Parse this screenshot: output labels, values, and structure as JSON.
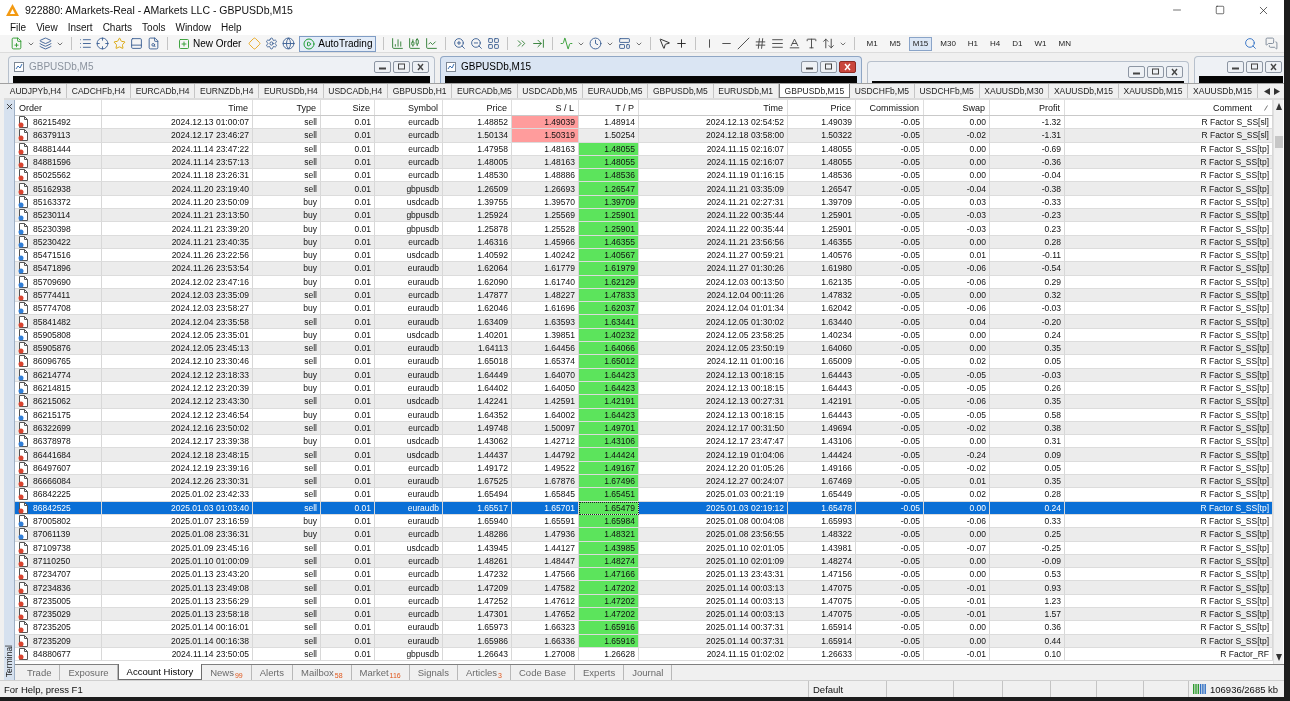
{
  "window": {
    "title": "922880: AMarkets-Real - AMarkets LLC - GBPUSDb,M15"
  },
  "menu": [
    "File",
    "View",
    "Insert",
    "Charts",
    "Tools",
    "Window",
    "Help"
  ],
  "toolbar": {
    "new_order": "New Order",
    "autotrading": {
      "label": "AutoTrading",
      "on": true
    },
    "timeframes": [
      {
        "label": "M1",
        "selected": false
      },
      {
        "label": "M5",
        "selected": false
      },
      {
        "label": "M15",
        "selected": true
      },
      {
        "label": "M30",
        "selected": false
      },
      {
        "label": "H1",
        "selected": false
      },
      {
        "label": "H4",
        "selected": false
      },
      {
        "label": "D1",
        "selected": false
      },
      {
        "label": "W1",
        "selected": false
      },
      {
        "label": "MN",
        "selected": false
      }
    ]
  },
  "chart_windows": [
    {
      "title": "GBPUSDb,M5",
      "active": false
    },
    {
      "title": "GBPUSDb,M15",
      "active": true
    },
    {
      "active": false
    },
    {
      "active": false
    }
  ],
  "chart_tabs": [
    {
      "label": "AUDJPYb,H4",
      "selected": false
    },
    {
      "label": "CADCHFb,H4",
      "selected": false
    },
    {
      "label": "EURCADb,H4",
      "selected": false
    },
    {
      "label": "EURNZDb,H4",
      "selected": false
    },
    {
      "label": "EURUSDb,H4",
      "selected": false
    },
    {
      "label": "USDCADb,H4",
      "selected": false
    },
    {
      "label": "GBPUSDb,H1",
      "selected": false
    },
    {
      "label": "EURCADb,M5",
      "selected": false
    },
    {
      "label": "USDCADb,M5",
      "selected": false
    },
    {
      "label": "EURAUDb,M5",
      "selected": false
    },
    {
      "label": "GBPUSDb,M5",
      "selected": false
    },
    {
      "label": "EURUSDb,M1",
      "selected": false
    },
    {
      "label": "GBPUSDb,M15",
      "selected": true
    },
    {
      "label": "USDCHFb,M5",
      "selected": false
    },
    {
      "label": "USDCHFb,M5",
      "selected": false
    },
    {
      "label": "XAUUSDb,M30",
      "selected": false
    },
    {
      "label": "XAUUSDb,M15",
      "selected": false
    },
    {
      "label": "XAUUSDb,M15",
      "selected": false
    },
    {
      "label": "XAUUSDb,M15",
      "selected": false
    }
  ],
  "terminal": {
    "title": "Terminal",
    "columns": [
      {
        "label": "Order",
        "sorted": false
      },
      {
        "label": "Time",
        "sorted": false
      },
      {
        "label": "Type",
        "sorted": false
      },
      {
        "label": "Size",
        "sorted": false
      },
      {
        "label": "Symbol",
        "sorted": false
      },
      {
        "label": "Price",
        "sorted": false
      },
      {
        "label": "S / L",
        "sorted": false
      },
      {
        "label": "T / P",
        "sorted": false
      },
      {
        "label": "Time",
        "sorted": false
      },
      {
        "label": "Price",
        "sorted": false
      },
      {
        "label": "Commission",
        "sorted": false
      },
      {
        "label": "Swap",
        "sorted": false
      },
      {
        "label": "Profit",
        "sorted": false
      },
      {
        "label": "Comment",
        "sorted": true
      }
    ],
    "rows": [
      {
        "order": "86215492",
        "open_time": "2024.12.13 01:00:07",
        "type": "sell",
        "size": "0.01",
        "symbol": "eurcadb",
        "open_price": "1.48852",
        "sl": "1.49039",
        "tp": "1.48914",
        "close_time": "2024.12.13 02:54:52",
        "close_price": "1.49039",
        "commission": "-0.05",
        "swap": "0.00",
        "profit": "-1.32",
        "comment": "R Factor S_SS[sl]",
        "color": "#d9432e",
        "sl_hit": true,
        "tp_hit": false,
        "selected": false
      },
      {
        "order": "86379113",
        "open_time": "2024.12.17 23:46:27",
        "type": "sell",
        "size": "0.01",
        "symbol": "eurcadb",
        "open_price": "1.50134",
        "sl": "1.50319",
        "tp": "1.50254",
        "close_time": "2024.12.18 03:58:00",
        "close_price": "1.50322",
        "commission": "-0.05",
        "swap": "-0.02",
        "profit": "-1.31",
        "comment": "R Factor S_SS[sl]",
        "color": "#d9432e",
        "sl_hit": true,
        "tp_hit": false,
        "selected": false
      },
      {
        "order": "84881444",
        "open_time": "2024.11.14 23:47:22",
        "type": "sell",
        "size": "0.01",
        "symbol": "eurcadb",
        "open_price": "1.47958",
        "sl": "1.48163",
        "tp": "1.48055",
        "close_time": "2024.11.15 02:16:07",
        "close_price": "1.48055",
        "commission": "-0.05",
        "swap": "0.00",
        "profit": "-0.69",
        "comment": "R Factor S_SS[tp]",
        "color": "#d9432e",
        "sl_hit": false,
        "tp_hit": true,
        "selected": false
      },
      {
        "order": "84881596",
        "open_time": "2024.11.14 23:57:13",
        "type": "sell",
        "size": "0.01",
        "symbol": "eurcadb",
        "open_price": "1.48005",
        "sl": "1.48163",
        "tp": "1.48055",
        "close_time": "2024.11.15 02:16:07",
        "close_price": "1.48055",
        "commission": "-0.05",
        "swap": "0.00",
        "profit": "-0.36",
        "comment": "R Factor S_SS[tp]",
        "color": "#d9432e",
        "sl_hit": false,
        "tp_hit": true,
        "selected": false
      },
      {
        "order": "85025562",
        "open_time": "2024.11.18 23:26:31",
        "type": "sell",
        "size": "0.01",
        "symbol": "eurcadb",
        "open_price": "1.48530",
        "sl": "1.48886",
        "tp": "1.48536",
        "close_time": "2024.11.19 01:16:15",
        "close_price": "1.48536",
        "commission": "-0.05",
        "swap": "0.00",
        "profit": "-0.04",
        "comment": "R Factor S_SS[tp]",
        "color": "#d9432e",
        "sl_hit": false,
        "tp_hit": true,
        "selected": false
      },
      {
        "order": "85162938",
        "open_time": "2024.11.20 23:19:40",
        "type": "sell",
        "size": "0.01",
        "symbol": "gbpusdb",
        "open_price": "1.26509",
        "sl": "1.26693",
        "tp": "1.26547",
        "close_time": "2024.11.21 03:35:09",
        "close_price": "1.26547",
        "commission": "-0.05",
        "swap": "-0.04",
        "profit": "-0.38",
        "comment": "R Factor S_SS[tp]",
        "color": "#d9432e",
        "sl_hit": false,
        "tp_hit": true,
        "selected": false
      },
      {
        "order": "85163372",
        "open_time": "2024.11.20 23:50:09",
        "type": "buy",
        "size": "0.01",
        "symbol": "usdcadb",
        "open_price": "1.39755",
        "sl": "1.39570",
        "tp": "1.39709",
        "close_time": "2024.11.21 02:27:31",
        "close_price": "1.39709",
        "commission": "-0.05",
        "swap": "0.03",
        "profit": "-0.33",
        "comment": "R Factor S_SS[tp]",
        "color": "#2f7ed8",
        "sl_hit": false,
        "tp_hit": true,
        "selected": false
      },
      {
        "order": "85230114",
        "open_time": "2024.11.21 23:13:50",
        "type": "buy",
        "size": "0.01",
        "symbol": "gbpusdb",
        "open_price": "1.25924",
        "sl": "1.25569",
        "tp": "1.25901",
        "close_time": "2024.11.22 00:35:44",
        "close_price": "1.25901",
        "commission": "-0.05",
        "swap": "-0.03",
        "profit": "-0.23",
        "comment": "R Factor S_SS[tp]",
        "color": "#2f7ed8",
        "sl_hit": false,
        "tp_hit": true,
        "selected": false
      },
      {
        "order": "85230398",
        "open_time": "2024.11.21 23:39:20",
        "type": "buy",
        "size": "0.01",
        "symbol": "gbpusdb",
        "open_price": "1.25878",
        "sl": "1.25528",
        "tp": "1.25901",
        "close_time": "2024.11.22 00:35:44",
        "close_price": "1.25901",
        "commission": "-0.05",
        "swap": "-0.03",
        "profit": "0.23",
        "comment": "R Factor S_SS[tp]",
        "color": "#2f7ed8",
        "sl_hit": false,
        "tp_hit": true,
        "selected": false
      },
      {
        "order": "85230422",
        "open_time": "2024.11.21 23:40:35",
        "type": "buy",
        "size": "0.01",
        "symbol": "eurcadb",
        "open_price": "1.46316",
        "sl": "1.45966",
        "tp": "1.46355",
        "close_time": "2024.11.21 23:56:56",
        "close_price": "1.46355",
        "commission": "-0.05",
        "swap": "0.00",
        "profit": "0.28",
        "comment": "R Factor S_SS[tp]",
        "color": "#2f7ed8",
        "sl_hit": false,
        "tp_hit": true,
        "selected": false
      },
      {
        "order": "85471516",
        "open_time": "2024.11.26 23:22:56",
        "type": "buy",
        "size": "0.01",
        "symbol": "usdcadb",
        "open_price": "1.40592",
        "sl": "1.40242",
        "tp": "1.40567",
        "close_time": "2024.11.27 00:59:21",
        "close_price": "1.40576",
        "commission": "-0.05",
        "swap": "0.01",
        "profit": "-0.11",
        "comment": "R Factor S_SS[tp]",
        "color": "#2f7ed8",
        "sl_hit": false,
        "tp_hit": true,
        "selected": false
      },
      {
        "order": "85471896",
        "open_time": "2024.11.26 23:53:54",
        "type": "buy",
        "size": "0.01",
        "symbol": "euraudb",
        "open_price": "1.62064",
        "sl": "1.61779",
        "tp": "1.61979",
        "close_time": "2024.11.27 01:30:26",
        "close_price": "1.61980",
        "commission": "-0.05",
        "swap": "-0.06",
        "profit": "-0.54",
        "comment": "R Factor S_SS[tp]",
        "color": "#2f7ed8",
        "sl_hit": false,
        "tp_hit": true,
        "selected": false
      },
      {
        "order": "85709690",
        "open_time": "2024.12.02 23:47:16",
        "type": "buy",
        "size": "0.01",
        "symbol": "euraudb",
        "open_price": "1.62090",
        "sl": "1.61740",
        "tp": "1.62129",
        "close_time": "2024.12.03 00:13:50",
        "close_price": "1.62135",
        "commission": "-0.05",
        "swap": "-0.06",
        "profit": "0.29",
        "comment": "R Factor S_SS[tp]",
        "color": "#2f7ed8",
        "sl_hit": false,
        "tp_hit": true,
        "selected": false
      },
      {
        "order": "85774411",
        "open_time": "2024.12.03 23:35:09",
        "type": "sell",
        "size": "0.01",
        "symbol": "eurcadb",
        "open_price": "1.47877",
        "sl": "1.48227",
        "tp": "1.47833",
        "close_time": "2024.12.04 00:11:26",
        "close_price": "1.47832",
        "commission": "-0.05",
        "swap": "0.00",
        "profit": "0.32",
        "comment": "R Factor S_SS[tp]",
        "color": "#d9432e",
        "sl_hit": false,
        "tp_hit": true,
        "selected": false
      },
      {
        "order": "85774708",
        "open_time": "2024.12.03 23:58:27",
        "type": "buy",
        "size": "0.01",
        "symbol": "euraudb",
        "open_price": "1.62046",
        "sl": "1.61696",
        "tp": "1.62037",
        "close_time": "2024.12.04 01:01:34",
        "close_price": "1.62042",
        "commission": "-0.05",
        "swap": "-0.06",
        "profit": "-0.03",
        "comment": "R Factor S_SS[tp]",
        "color": "#2f7ed8",
        "sl_hit": false,
        "tp_hit": true,
        "selected": false
      },
      {
        "order": "85841482",
        "open_time": "2024.12.04 23:35:58",
        "type": "sell",
        "size": "0.01",
        "symbol": "euraudb",
        "open_price": "1.63409",
        "sl": "1.63593",
        "tp": "1.63441",
        "close_time": "2024.12.05 01:30:02",
        "close_price": "1.63440",
        "commission": "-0.05",
        "swap": "0.04",
        "profit": "-0.20",
        "comment": "R Factor S_SS[tp]",
        "color": "#d9432e",
        "sl_hit": false,
        "tp_hit": true,
        "selected": false
      },
      {
        "order": "85905808",
        "open_time": "2024.12.05 23:35:01",
        "type": "buy",
        "size": "0.01",
        "symbol": "usdcadb",
        "open_price": "1.40201",
        "sl": "1.39851",
        "tp": "1.40232",
        "close_time": "2024.12.05 23:58:25",
        "close_price": "1.40234",
        "commission": "-0.05",
        "swap": "0.00",
        "profit": "0.24",
        "comment": "R Factor S_SS[tp]",
        "color": "#2f7ed8",
        "sl_hit": false,
        "tp_hit": true,
        "selected": false
      },
      {
        "order": "85905876",
        "open_time": "2024.12.05 23:45:13",
        "type": "sell",
        "size": "0.01",
        "symbol": "euraudb",
        "open_price": "1.64113",
        "sl": "1.64456",
        "tp": "1.64066",
        "close_time": "2024.12.05 23:50:19",
        "close_price": "1.64060",
        "commission": "-0.05",
        "swap": "0.00",
        "profit": "0.35",
        "comment": "R Factor S_SS[tp]",
        "color": "#d9432e",
        "sl_hit": false,
        "tp_hit": true,
        "selected": false
      },
      {
        "order": "86096765",
        "open_time": "2024.12.10 23:30:46",
        "type": "sell",
        "size": "0.01",
        "symbol": "euraudb",
        "open_price": "1.65018",
        "sl": "1.65374",
        "tp": "1.65012",
        "close_time": "2024.12.11 01:00:16",
        "close_price": "1.65009",
        "commission": "-0.05",
        "swap": "0.02",
        "profit": "0.05",
        "comment": "R Factor S_SS[tp]",
        "color": "#d9432e",
        "sl_hit": false,
        "tp_hit": true,
        "selected": false
      },
      {
        "order": "86214774",
        "open_time": "2024.12.12 23:18:33",
        "type": "buy",
        "size": "0.01",
        "symbol": "euraudb",
        "open_price": "1.64449",
        "sl": "1.64070",
        "tp": "1.64423",
        "close_time": "2024.12.13 00:18:15",
        "close_price": "1.64443",
        "commission": "-0.05",
        "swap": "-0.05",
        "profit": "-0.03",
        "comment": "R Factor S_SS[tp]",
        "color": "#2f7ed8",
        "sl_hit": false,
        "tp_hit": true,
        "selected": false
      },
      {
        "order": "86214815",
        "open_time": "2024.12.12 23:20:39",
        "type": "buy",
        "size": "0.01",
        "symbol": "euraudb",
        "open_price": "1.64402",
        "sl": "1.64050",
        "tp": "1.64423",
        "close_time": "2024.12.13 00:18:15",
        "close_price": "1.64443",
        "commission": "-0.05",
        "swap": "-0.05",
        "profit": "0.26",
        "comment": "R Factor S_SS[tp]",
        "color": "#2f7ed8",
        "sl_hit": false,
        "tp_hit": true,
        "selected": false
      },
      {
        "order": "86215062",
        "open_time": "2024.12.12 23:43:30",
        "type": "sell",
        "size": "0.01",
        "symbol": "usdcadb",
        "open_price": "1.42241",
        "sl": "1.42591",
        "tp": "1.42191",
        "close_time": "2024.12.13 00:27:31",
        "close_price": "1.42191",
        "commission": "-0.05",
        "swap": "-0.06",
        "profit": "0.35",
        "comment": "R Factor S_SS[tp]",
        "color": "#d9432e",
        "sl_hit": false,
        "tp_hit": true,
        "selected": false
      },
      {
        "order": "86215175",
        "open_time": "2024.12.12 23:46:54",
        "type": "buy",
        "size": "0.01",
        "symbol": "euraudb",
        "open_price": "1.64352",
        "sl": "1.64002",
        "tp": "1.64423",
        "close_time": "2024.12.13 00:18:15",
        "close_price": "1.64443",
        "commission": "-0.05",
        "swap": "-0.05",
        "profit": "0.58",
        "comment": "R Factor S_SS[tp]",
        "color": "#2f7ed8",
        "sl_hit": false,
        "tp_hit": true,
        "selected": false
      },
      {
        "order": "86322699",
        "open_time": "2024.12.16 23:50:02",
        "type": "sell",
        "size": "0.01",
        "symbol": "eurcadb",
        "open_price": "1.49748",
        "sl": "1.50097",
        "tp": "1.49701",
        "close_time": "2024.12.17 00:31:50",
        "close_price": "1.49694",
        "commission": "-0.05",
        "swap": "-0.02",
        "profit": "0.38",
        "comment": "R Factor S_SS[tp]",
        "color": "#d9432e",
        "sl_hit": false,
        "tp_hit": true,
        "selected": false
      },
      {
        "order": "86378978",
        "open_time": "2024.12.17 23:39:38",
        "type": "buy",
        "size": "0.01",
        "symbol": "usdcadb",
        "open_price": "1.43062",
        "sl": "1.42712",
        "tp": "1.43106",
        "close_time": "2024.12.17 23:47:47",
        "close_price": "1.43106",
        "commission": "-0.05",
        "swap": "0.00",
        "profit": "0.31",
        "comment": "R Factor S_SS[tp]",
        "color": "#2f7ed8",
        "sl_hit": false,
        "tp_hit": true,
        "selected": false
      },
      {
        "order": "86441684",
        "open_time": "2024.12.18 23:48:15",
        "type": "sell",
        "size": "0.01",
        "symbol": "usdcadb",
        "open_price": "1.44437",
        "sl": "1.44792",
        "tp": "1.44424",
        "close_time": "2024.12.19 01:04:06",
        "close_price": "1.44424",
        "commission": "-0.05",
        "swap": "-0.24",
        "profit": "0.09",
        "comment": "R Factor S_SS[tp]",
        "color": "#d9432e",
        "sl_hit": false,
        "tp_hit": true,
        "selected": false
      },
      {
        "order": "86497607",
        "open_time": "2024.12.19 23:39:16",
        "type": "sell",
        "size": "0.01",
        "symbol": "eurcadb",
        "open_price": "1.49172",
        "sl": "1.49522",
        "tp": "1.49167",
        "close_time": "2024.12.20 01:05:26",
        "close_price": "1.49166",
        "commission": "-0.05",
        "swap": "-0.02",
        "profit": "0.05",
        "comment": "R Factor S_SS[tp]",
        "color": "#d9432e",
        "sl_hit": false,
        "tp_hit": true,
        "selected": false
      },
      {
        "order": "86666084",
        "open_time": "2024.12.26 23:30:31",
        "type": "sell",
        "size": "0.01",
        "symbol": "euraudb",
        "open_price": "1.67525",
        "sl": "1.67876",
        "tp": "1.67496",
        "close_time": "2024.12.27 00:24:07",
        "close_price": "1.67469",
        "commission": "-0.05",
        "swap": "0.01",
        "profit": "0.35",
        "comment": "R Factor S_SS[tp]",
        "color": "#d9432e",
        "sl_hit": false,
        "tp_hit": true,
        "selected": false
      },
      {
        "order": "86842225",
        "open_time": "2025.01.02 23:42:33",
        "type": "sell",
        "size": "0.01",
        "symbol": "euraudb",
        "open_price": "1.65494",
        "sl": "1.65845",
        "tp": "1.65451",
        "close_time": "2025.01.03 00:21:19",
        "close_price": "1.65449",
        "commission": "-0.05",
        "swap": "0.02",
        "profit": "0.28",
        "comment": "R Factor S_SS[tp]",
        "color": "#d9432e",
        "sl_hit": false,
        "tp_hit": true,
        "selected": false
      },
      {
        "order": "86842525",
        "open_time": "2025.01.03 01:03:40",
        "type": "sell",
        "size": "0.01",
        "symbol": "euraudb",
        "open_price": "1.65517",
        "sl": "1.65701",
        "tp": "1.65479",
        "close_time": "2025.01.03 02:19:12",
        "close_price": "1.65478",
        "commission": "-0.05",
        "swap": "0.00",
        "profit": "0.24",
        "comment": "R Factor S_SS[tp]",
        "color": "#d9432e",
        "sl_hit": false,
        "tp_hit": true,
        "selected": true
      },
      {
        "order": "87005802",
        "open_time": "2025.01.07 23:16:59",
        "type": "buy",
        "size": "0.01",
        "symbol": "euraudb",
        "open_price": "1.65940",
        "sl": "1.65591",
        "tp": "1.65984",
        "close_time": "2025.01.08 00:04:08",
        "close_price": "1.65993",
        "commission": "-0.05",
        "swap": "-0.06",
        "profit": "0.33",
        "comment": "R Factor S_SS[tp]",
        "color": "#2f7ed8",
        "sl_hit": false,
        "tp_hit": true,
        "selected": false
      },
      {
        "order": "87061139",
        "open_time": "2025.01.08 23:36:31",
        "type": "buy",
        "size": "0.01",
        "symbol": "eurcadb",
        "open_price": "1.48286",
        "sl": "1.47936",
        "tp": "1.48321",
        "close_time": "2025.01.08 23:56:55",
        "close_price": "1.48322",
        "commission": "-0.05",
        "swap": "0.00",
        "profit": "0.25",
        "comment": "R Factor S_SS[tp]",
        "color": "#2f7ed8",
        "sl_hit": false,
        "tp_hit": true,
        "selected": false
      },
      {
        "order": "87109738",
        "open_time": "2025.01.09 23:45:16",
        "type": "sell",
        "size": "0.01",
        "symbol": "usdcadb",
        "open_price": "1.43945",
        "sl": "1.44127",
        "tp": "1.43985",
        "close_time": "2025.01.10 02:01:05",
        "close_price": "1.43981",
        "commission": "-0.05",
        "swap": "-0.07",
        "profit": "-0.25",
        "comment": "R Factor S_SS[tp]",
        "color": "#d9432e",
        "sl_hit": false,
        "tp_hit": true,
        "selected": false
      },
      {
        "order": "87110250",
        "open_time": "2025.01.10 01:00:09",
        "type": "sell",
        "size": "0.01",
        "symbol": "eurcadb",
        "open_price": "1.48261",
        "sl": "1.48447",
        "tp": "1.48274",
        "close_time": "2025.01.10 02:01:09",
        "close_price": "1.48274",
        "commission": "-0.05",
        "swap": "0.00",
        "profit": "-0.09",
        "comment": "R Factor S_SS[tp]",
        "color": "#d9432e",
        "sl_hit": false,
        "tp_hit": true,
        "selected": false
      },
      {
        "order": "87234707",
        "open_time": "2025.01.13 23:43:20",
        "type": "sell",
        "size": "0.01",
        "symbol": "eurcadb",
        "open_price": "1.47232",
        "sl": "1.47566",
        "tp": "1.47166",
        "close_time": "2025.01.13 23:43:31",
        "close_price": "1.47156",
        "commission": "-0.05",
        "swap": "0.00",
        "profit": "0.53",
        "comment": "R Factor S_SS[tp]",
        "color": "#d9432e",
        "sl_hit": false,
        "tp_hit": true,
        "selected": false
      },
      {
        "order": "87234836",
        "open_time": "2025.01.13 23:49:08",
        "type": "sell",
        "size": "0.01",
        "symbol": "eurcadb",
        "open_price": "1.47209",
        "sl": "1.47582",
        "tp": "1.47202",
        "close_time": "2025.01.14 00:03:13",
        "close_price": "1.47075",
        "commission": "-0.05",
        "swap": "-0.01",
        "profit": "0.93",
        "comment": "R Factor S_SS[tp]",
        "color": "#d9432e",
        "sl_hit": false,
        "tp_hit": true,
        "selected": false
      },
      {
        "order": "87235005",
        "open_time": "2025.01.13 23:56:29",
        "type": "sell",
        "size": "0.01",
        "symbol": "eurcadb",
        "open_price": "1.47252",
        "sl": "1.47612",
        "tp": "1.47202",
        "close_time": "2025.01.14 00:03:13",
        "close_price": "1.47075",
        "commission": "-0.05",
        "swap": "-0.01",
        "profit": "1.23",
        "comment": "R Factor S_SS[tp]",
        "color": "#d9432e",
        "sl_hit": false,
        "tp_hit": true,
        "selected": false
      },
      {
        "order": "87235029",
        "open_time": "2025.01.13 23:58:18",
        "type": "sell",
        "size": "0.01",
        "symbol": "eurcadb",
        "open_price": "1.47301",
        "sl": "1.47652",
        "tp": "1.47202",
        "close_time": "2025.01.14 00:03:13",
        "close_price": "1.47075",
        "commission": "-0.05",
        "swap": "-0.01",
        "profit": "1.57",
        "comment": "R Factor S_SS[tp]",
        "color": "#d9432e",
        "sl_hit": false,
        "tp_hit": true,
        "selected": false
      },
      {
        "order": "87235205",
        "open_time": "2025.01.14 00:16:01",
        "type": "sell",
        "size": "0.01",
        "symbol": "euraudb",
        "open_price": "1.65973",
        "sl": "1.66323",
        "tp": "1.65916",
        "close_time": "2025.01.14 00:37:31",
        "close_price": "1.65914",
        "commission": "-0.05",
        "swap": "0.00",
        "profit": "0.36",
        "comment": "R Factor S_SS[tp]",
        "color": "#d9432e",
        "sl_hit": false,
        "tp_hit": true,
        "selected": false
      },
      {
        "order": "87235209",
        "open_time": "2025.01.14 00:16:38",
        "type": "sell",
        "size": "0.01",
        "symbol": "euraudb",
        "open_price": "1.65986",
        "sl": "1.66336",
        "tp": "1.65916",
        "close_time": "2025.01.14 00:37:31",
        "close_price": "1.65914",
        "commission": "-0.05",
        "swap": "0.00",
        "profit": "0.44",
        "comment": "R Factor S_SS[tp]",
        "color": "#d9432e",
        "sl_hit": false,
        "tp_hit": true,
        "selected": false
      },
      {
        "order": "84880677",
        "open_time": "2024.11.14 23:50:05",
        "type": "sell",
        "size": "0.01",
        "symbol": "gbpusdb",
        "open_price": "1.26643",
        "sl": "1.27008",
        "tp": "1.26628",
        "close_time": "2024.11.15 01:02:02",
        "close_price": "1.26633",
        "commission": "-0.05",
        "swap": "-0.01",
        "profit": "0.10",
        "comment": "R Factor_RF",
        "color": "#d9432e",
        "sl_hit": false,
        "tp_hit": false,
        "selected": false
      }
    ],
    "tabs": [
      {
        "label": "Trade",
        "selected": false
      },
      {
        "label": "Exposure",
        "selected": false
      },
      {
        "label": "Account History",
        "selected": true
      },
      {
        "label": "News",
        "count": "99",
        "selected": false
      },
      {
        "label": "Alerts",
        "selected": false
      },
      {
        "label": "Mailbox",
        "count": "58",
        "selected": false
      },
      {
        "label": "Market",
        "count": "116",
        "selected": false
      },
      {
        "label": "Signals",
        "selected": false
      },
      {
        "label": "Articles",
        "count": "3",
        "selected": false
      },
      {
        "label": "Code Base",
        "selected": false
      },
      {
        "label": "Experts",
        "selected": false
      },
      {
        "label": "Journal",
        "selected": false
      }
    ]
  },
  "status_bar": {
    "help": "For Help, press F1",
    "profile": "Default",
    "traffic": "106936/2685 kb"
  }
}
